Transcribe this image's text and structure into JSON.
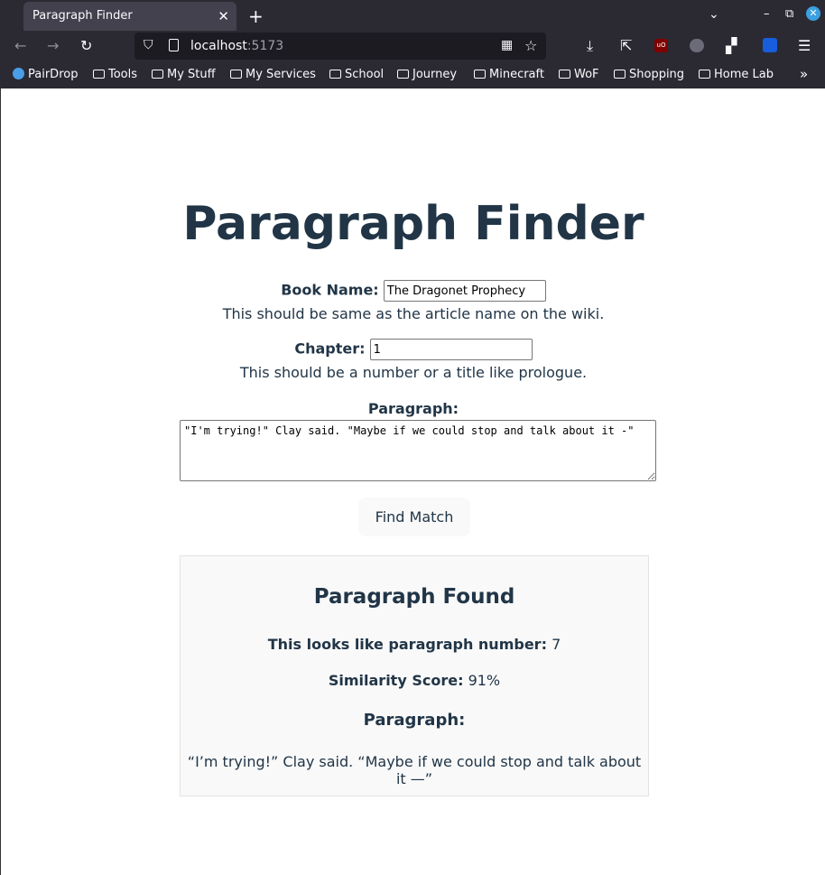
{
  "browser": {
    "tab_title": "Paragraph Finder",
    "url_host": "localhost",
    "url_port": ":5173",
    "bookmarks": [
      "PairDrop",
      "Tools",
      "My Stuff",
      "My Services",
      "School",
      "Journey",
      "Minecraft",
      "WoF",
      "Shopping",
      "Home Lab"
    ]
  },
  "page": {
    "title": "Paragraph Finder",
    "book": {
      "label": "Book Name:",
      "value": "The Dragonet Prophecy",
      "hint": "This should be same as the article name on the wiki."
    },
    "chapter": {
      "label": "Chapter:",
      "value": "1",
      "hint": "This should be a number or a title like prologue."
    },
    "paragraph": {
      "label": "Paragraph:",
      "value": "\"I'm trying!\" Clay said. \"Maybe if we could stop and talk about it -\""
    },
    "button": "Find Match",
    "result": {
      "heading": "Paragraph Found",
      "number_label": "This looks like paragraph number:",
      "number_value": "7",
      "score_label": "Similarity Score:",
      "score_value": "91%",
      "para_heading": "Paragraph:",
      "para_text": "“I’m trying!” Clay said. “Maybe if we could stop and talk about it —”"
    }
  }
}
